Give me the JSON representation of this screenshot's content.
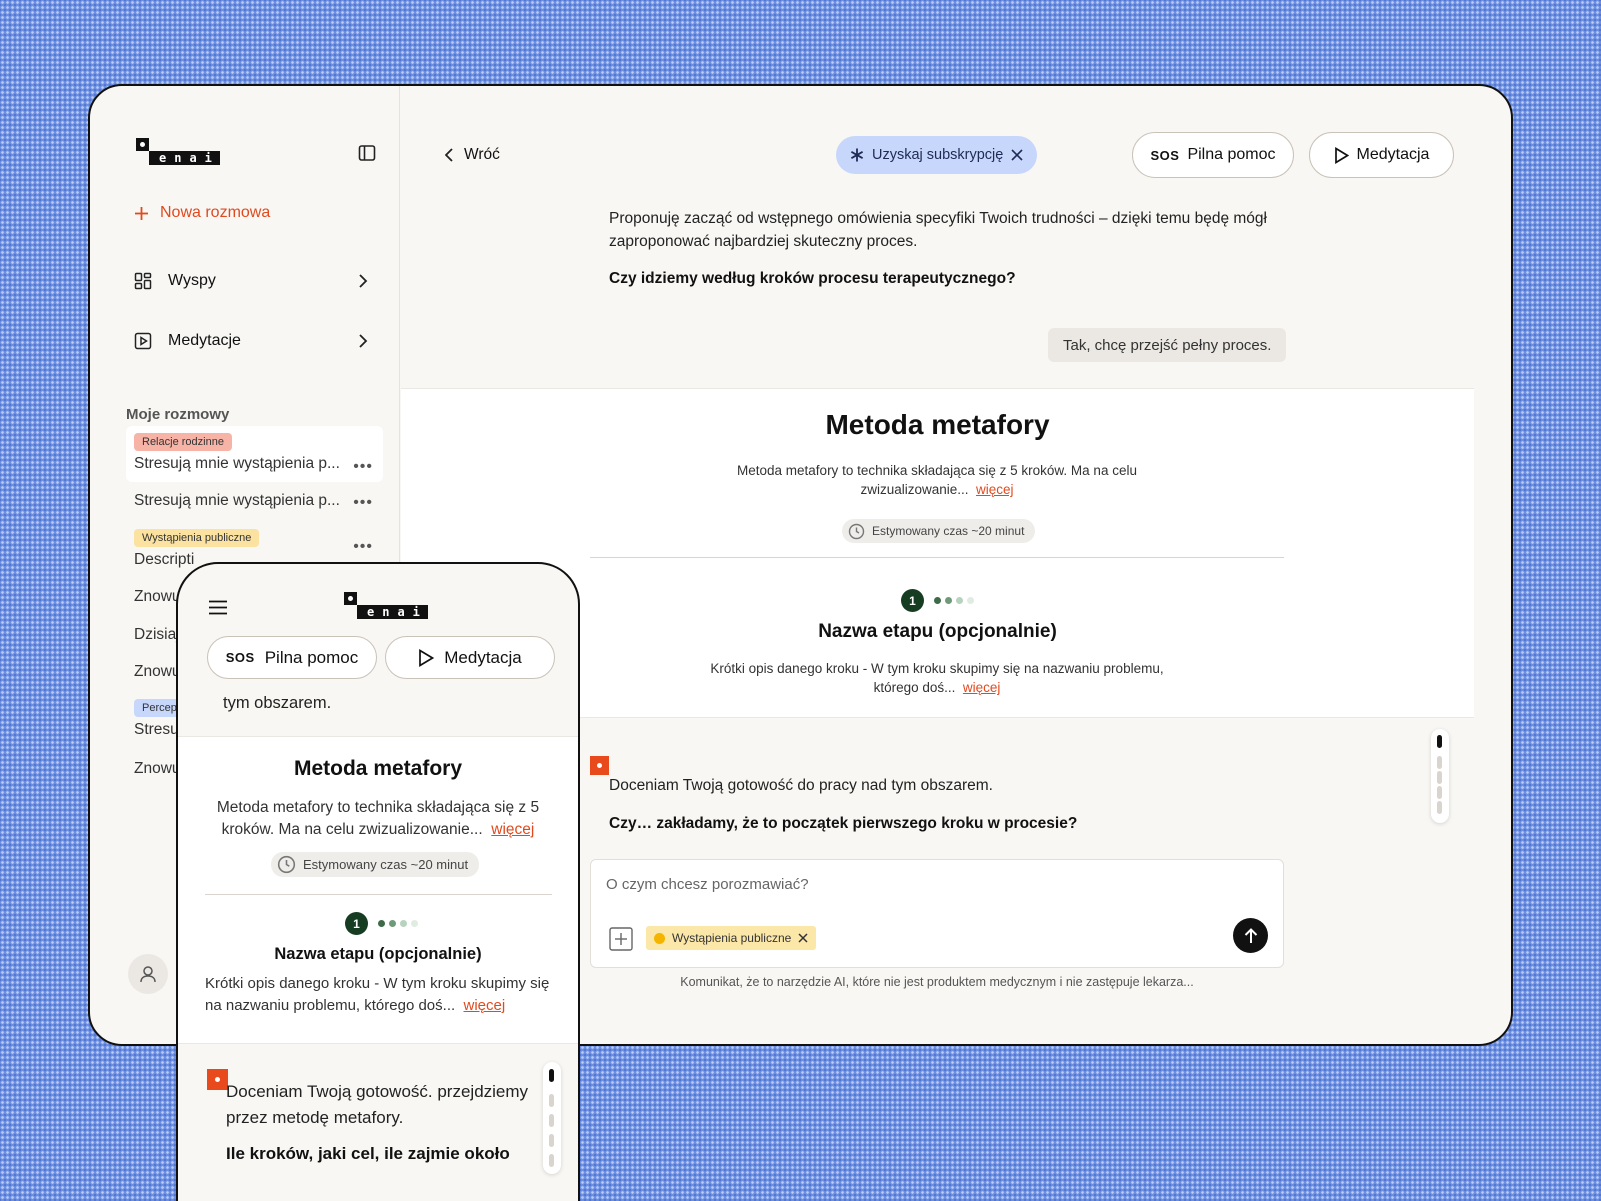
{
  "brand": {
    "logo_text": "enai"
  },
  "sidebar": {
    "new_chat": "Nowa rozmowa",
    "nav": [
      {
        "label": "Wyspy",
        "icon": "grid-icon"
      },
      {
        "label": "Medytacje",
        "icon": "play-square-icon"
      }
    ],
    "conversations_title": "Moje rozmowy",
    "conversations": [
      {
        "tag": "Relacje rodzinne",
        "tag_color": "#f6b3a6",
        "title": "Stresują mnie wystąpienia p...",
        "active": true
      },
      {
        "tag": "",
        "title": "Stresują mnie wystąpienia p..."
      },
      {
        "tag": "Wystąpienia publiczne",
        "tag_color": "#fbe2a0",
        "title": "Descripti"
      },
      {
        "tag": "",
        "title": "Znowu"
      },
      {
        "tag": "",
        "title": "Dzisiaj"
      },
      {
        "tag": "",
        "title": "Znowu"
      },
      {
        "tag": "Percep",
        "tag_color": "#c7d6fb",
        "title": "Stresu"
      },
      {
        "tag": "",
        "title": "Znowu"
      }
    ],
    "more_glyph": "•••"
  },
  "header": {
    "back": "Wróć",
    "subscription": "Uzyskaj subskrypcję",
    "sos_label": "SOS",
    "help": "Pilna pomoc",
    "meditation": "Medytacja"
  },
  "chat": {
    "assistant_intro": "Proponuję zacząć od wstępnego omówienia specyfiki Twoich trudności – dzięki temu będę mógł zaproponować najbardziej skuteczny proces.",
    "assistant_question": "Czy idziemy według kroków procesu terapeutycznego?",
    "user_reply": "Tak, chcę przejść pełny proces.",
    "method": {
      "title": "Metoda metafory",
      "description": "Metoda metafory to technika składająca się z 5 kroków. Ma na celu zwizualizowanie...",
      "more": "więcej",
      "time": "Estymowany czas ~20 minut",
      "step_number": "1",
      "step_title": "Nazwa etapu (opcjonalnie)",
      "step_description": "Krótki opis danego kroku - W tym kroku skupimy się na nazwaniu problemu, którego doś...",
      "step_dot_colors": [
        "#3d6a48",
        "#6f9a78",
        "#b7d3bd",
        "#e0ece2"
      ]
    },
    "assistant_reply": "Doceniam Twoją gotowość do pracy nad tym obszarem.",
    "assistant_reply_question": "Czy… zakładamy, że to początek pierwszego kroku w procesie?"
  },
  "composer": {
    "placeholder": "O czym chcesz porozmawiać?",
    "topic_chip": "Wystąpienia publiczne",
    "disclaimer": "Komunikat, że to narzędzie AI, które nie jest produktem medycznym i nie zastępuje lekarza..."
  },
  "mobile": {
    "sos_label": "SOS",
    "help": "Pilna pomoc",
    "meditation": "Medytacja",
    "peek_text": "tym obszarem.",
    "method_title": "Metoda metafory",
    "method_description": "Metoda metafory to technika składająca się z 5 kroków. Ma na celu zwizualizowanie...",
    "more": "więcej",
    "time": "Estymowany czas ~20 minut",
    "step_number": "1",
    "step_title": "Nazwa etapu (opcjonalnie)",
    "step_description": "Krótki opis danego kroku - W tym kroku skupimy się na nazwaniu problemu, którego doś...",
    "message": "Doceniam Twoją gotowość. przejdziemy przez metodę metafory.",
    "question": "Ile kroków, jaki cel, ile zajmie około"
  },
  "colors": {
    "accent": "#e04a1f",
    "background": "#6b8fe3",
    "surface": "#f8f7f4",
    "subscription_chip": "#c7d6fb",
    "step_green": "#163d22"
  }
}
